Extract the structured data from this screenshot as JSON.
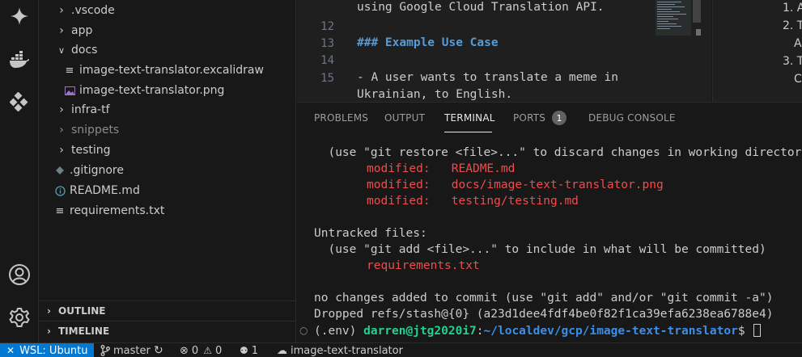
{
  "activity_bar": {
    "icons": [
      "gemini-icon",
      "docker-icon",
      "extensions-icon",
      "account-icon",
      "settings-gear-icon"
    ]
  },
  "explorer": {
    "items": [
      {
        "label": ".vscode",
        "type": "folder",
        "expanded": false
      },
      {
        "label": "app",
        "type": "folder",
        "expanded": false
      },
      {
        "label": "docs",
        "type": "folder",
        "expanded": true
      },
      {
        "label": "image-text-translator.excalidraw",
        "type": "file"
      },
      {
        "label": "image-text-translator.png",
        "type": "image"
      },
      {
        "label": "infra-tf",
        "type": "folder",
        "expanded": false
      },
      {
        "label": "snippets",
        "type": "folder",
        "expanded": false,
        "dimmed": true
      },
      {
        "label": "testing",
        "type": "folder",
        "expanded": false
      },
      {
        "label": ".gitignore",
        "type": "gitignore"
      },
      {
        "label": "README.md",
        "type": "info"
      },
      {
        "label": "requirements.txt",
        "type": "file"
      }
    ],
    "sections": {
      "outline": "OUTLINE",
      "timeline": "TIMELINE"
    }
  },
  "editor": {
    "lines": [
      {
        "num": "",
        "text": "using Google Cloud Translation API."
      },
      {
        "num": "12",
        "text": ""
      },
      {
        "num": "13",
        "text": "### Example Use Case"
      },
      {
        "num": "14",
        "text": ""
      },
      {
        "num": "15",
        "text": "- A user wants to translate a meme in"
      },
      {
        "num": "",
        "text": "Ukrainian, to English."
      }
    ],
    "preview_lines": [
      "1. A",
      "2. T",
      "A",
      "3. T",
      "C"
    ]
  },
  "panel": {
    "tabs": [
      "PROBLEMS",
      "OUTPUT",
      "TERMINAL",
      "PORTS",
      "DEBUG CONSOLE"
    ],
    "active_tab": "TERMINAL",
    "ports_badge": "1",
    "terminal": {
      "line1": "  (use \"git restore <file>...\" to discard changes in working directory)",
      "modified_label": "modified:",
      "modified_files": [
        "README.md",
        "docs/image-text-translator.png",
        "testing/testing.md"
      ],
      "untracked_header": "Untracked files:",
      "untracked_hint": "  (use \"git add <file>...\" to include in what will be committed)",
      "untracked_file": "requirements.txt",
      "no_changes": "no changes added to commit (use \"git add\" and/or \"git commit -a\")",
      "dropped": "Dropped refs/stash@{0} (a23d1dee4fdf4be0f82f1ca39efa6238ea6788e4)",
      "prompt_env": "(.env) ",
      "prompt_user": "darren@jtg2020i7",
      "prompt_sep": ":",
      "prompt_path": "~/localdev/gcp/image-text-translator",
      "prompt_end": "$ "
    }
  },
  "statusbar": {
    "remote": "WSL: Ubuntu",
    "branch": "master",
    "errors": "0",
    "warnings": "0",
    "ports": "1",
    "workspace": "image-text-translator"
  },
  "colors": {
    "accent": "#0078d4",
    "git_red": "#f14c4c",
    "prompt_green": "#23d18b",
    "prompt_blue": "#3b8eea"
  }
}
